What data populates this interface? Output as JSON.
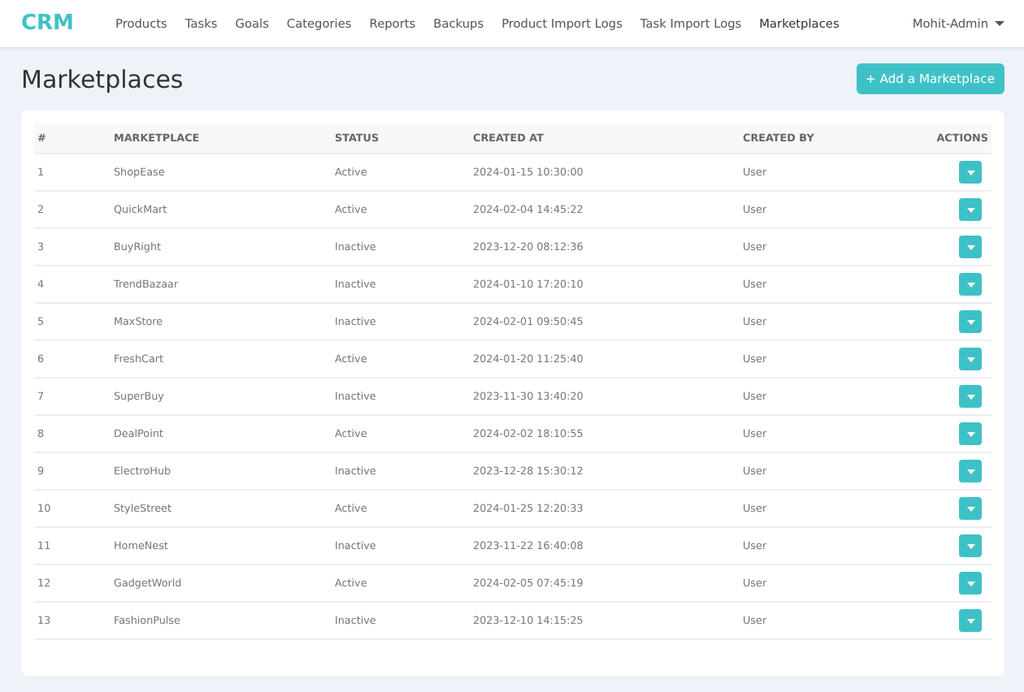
{
  "navbar": {
    "brand": "CRM",
    "links": [
      {
        "label": "Products",
        "selected": false
      },
      {
        "label": "Tasks",
        "selected": false
      },
      {
        "label": "Goals",
        "selected": false
      },
      {
        "label": "Categories",
        "selected": false
      },
      {
        "label": "Reports",
        "selected": false
      },
      {
        "label": "Backups",
        "selected": false
      },
      {
        "label": "Product Import Logs",
        "selected": false
      },
      {
        "label": "Task Import Logs",
        "selected": false
      },
      {
        "label": "Marketplaces",
        "selected": true
      }
    ],
    "user": "Mohit-Admin"
  },
  "page_title": "Marketplaces",
  "add_button": "+ Add a Marketplace",
  "table": {
    "columns": [
      "#",
      "MARKETPLACE",
      "STATUS",
      "CREATED AT",
      "CREATED BY",
      "ACTIONS"
    ],
    "rows": [
      {
        "number": "1",
        "marketplace": "ShopEase",
        "status": "Active",
        "created_at": "2024-01-15 10:30:00",
        "created_by": "User"
      },
      {
        "number": "2",
        "marketplace": "QuickMart",
        "status": "Active",
        "created_at": "2024-02-04 14:45:22",
        "created_by": "User"
      },
      {
        "number": "3",
        "marketplace": "BuyRight",
        "status": "Inactive",
        "created_at": "2023-12-20 08:12:36",
        "created_by": "User"
      },
      {
        "number": "4",
        "marketplace": "TrendBazaar",
        "status": "Inactive",
        "created_at": "2024-01-10 17:20:10",
        "created_by": "User"
      },
      {
        "number": "5",
        "marketplace": "MaxStore",
        "status": "Inactive",
        "created_at": "2024-02-01 09:50:45",
        "created_by": "User"
      },
      {
        "number": "6",
        "marketplace": "FreshCart",
        "status": "Active",
        "created_at": "2024-01-20 11:25:40",
        "created_by": "User"
      },
      {
        "number": "7",
        "marketplace": "SuperBuy",
        "status": "Inactive",
        "created_at": "2023-11-30 13:40:20",
        "created_by": "User"
      },
      {
        "number": "8",
        "marketplace": "DealPoint",
        "status": "Active",
        "created_at": "2024-02-02 18:10:55",
        "created_by": "User"
      },
      {
        "number": "9",
        "marketplace": "ElectroHub",
        "status": "Inactive",
        "created_at": "2023-12-28 15:30:12",
        "created_by": "User"
      },
      {
        "number": "10",
        "marketplace": "StyleStreet",
        "status": "Active",
        "created_at": "2024-01-25 12:20:33",
        "created_by": "User"
      },
      {
        "number": "11",
        "marketplace": "HomeNest",
        "status": "Inactive",
        "created_at": "2023-11-22 16:40:08",
        "created_by": "User"
      },
      {
        "number": "12",
        "marketplace": "GadgetWorld",
        "status": "Active",
        "created_at": "2024-02-05 07:45:19",
        "created_by": "User"
      },
      {
        "number": "13",
        "marketplace": "FashionPulse",
        "status": "Inactive",
        "created_at": "2023-12-10 14:15:25",
        "created_by": "User"
      }
    ]
  }
}
